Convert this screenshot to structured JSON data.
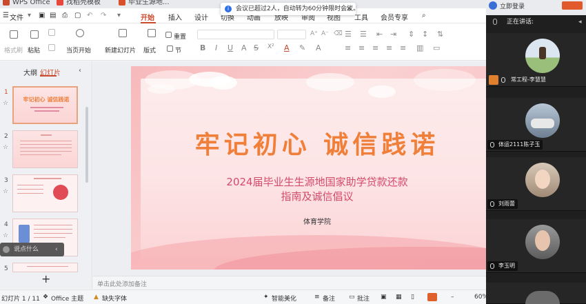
{
  "tabs": [
    {
      "label": "WPS Office"
    },
    {
      "label": "找稻壳模板"
    },
    {
      "label": "毕业生源地..."
    }
  ],
  "toast": {
    "text": "会议已超过2人，自动转为60分钟限时会议。"
  },
  "menu": {
    "file": "文件",
    "items": [
      "开始",
      "插入",
      "设计",
      "切换",
      "动画",
      "放映",
      "审阅",
      "视图",
      "工具",
      "会员专享"
    ],
    "active": "开始"
  },
  "toolbar": {
    "format_painter": "格式刷",
    "paste": "粘贴",
    "play_from_current": "当页开始",
    "new_slide": "新建幻灯片",
    "layout": "版式",
    "section": "节",
    "reset": "重置"
  },
  "left_panel": {
    "tab_outline": "大纲",
    "tab_slides": "幻灯片",
    "slide_numbers": [
      "1",
      "2",
      "3",
      "4",
      "5"
    ],
    "thumb1_title": "牢记初心 诚信践诺",
    "ask_placeholder": "说点什么",
    "add_label": "+"
  },
  "slide": {
    "title": "牢记初心  诚信践诺",
    "subtitle1": "2024届毕业生生源地国家助学贷款还款",
    "subtitle2": "指南及诚信倡议",
    "school": "体育学院"
  },
  "notes": {
    "placeholder": "单击此处添加备注"
  },
  "status": {
    "slide_counter": "幻灯片 1 / 11",
    "theme": "Office 主题",
    "missing_font": "缺失字体",
    "smart_beautify": "智能美化",
    "notes_btn": "备注",
    "comments_btn": "批注",
    "zoom": "60%"
  },
  "meeting": {
    "speaking_label": "正在讲话:",
    "login": "立即登录",
    "participants": [
      {
        "name": "常工程-李慧慧"
      },
      {
        "name": "体运2111陈子玉"
      },
      {
        "name": "刘雨蕾"
      },
      {
        "name": "李玉明"
      }
    ]
  },
  "colors": {
    "accent": "#c9492c",
    "title_orange": "#f07f3a",
    "subtitle_pink": "#d44a6a",
    "slide_bg": "#fde4e5",
    "meeting_bg": "#1f1f1f"
  }
}
